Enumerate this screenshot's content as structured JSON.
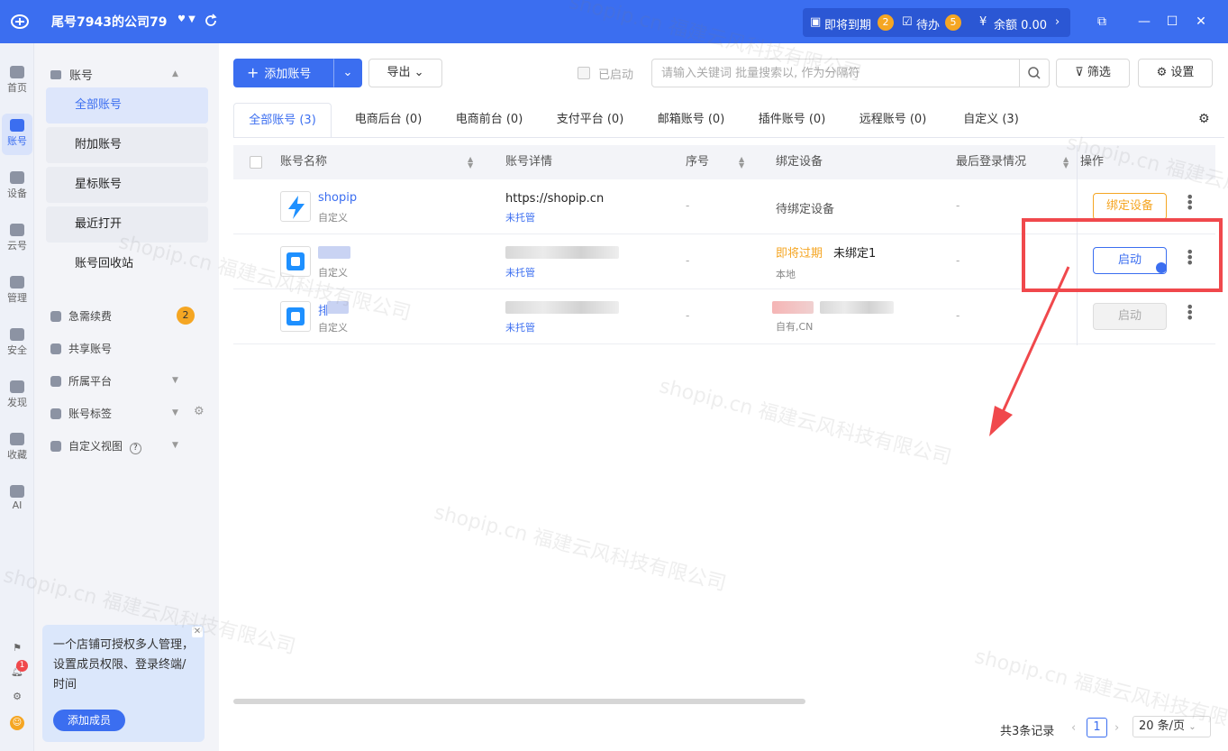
{
  "titlebar": {
    "company": "尾号7943的公司79",
    "expiring_label": "即将到期",
    "expiring_count": "2",
    "todo_label": "待办",
    "todo_count": "5",
    "balance_label": "余额 0.00"
  },
  "rail": [
    {
      "label": "首页"
    },
    {
      "label": "账号"
    },
    {
      "label": "设备"
    },
    {
      "label": "云号"
    },
    {
      "label": "管理"
    },
    {
      "label": "安全"
    },
    {
      "label": "发现"
    },
    {
      "label": "收藏"
    },
    {
      "label": "AI"
    }
  ],
  "notification_count": "1",
  "sidebar": {
    "section_title": "账号",
    "items": [
      "全部账号",
      "附加账号",
      "星标账号",
      "最近打开",
      "账号回收站"
    ],
    "groups": [
      {
        "label": "急需续费",
        "badge": "2"
      },
      {
        "label": "共享账号"
      },
      {
        "label": "所属平台"
      },
      {
        "label": "账号标签"
      },
      {
        "label": "自定义视图"
      }
    ],
    "promo_text": "一个店铺可授权多人管理，设置成员权限、登录终端/时间",
    "promo_button": "添加成员"
  },
  "toolbar": {
    "add_account": "添加账号",
    "export": "导出",
    "launched_label": "已启动",
    "search_placeholder": "请输入关键词 批量搜索以, 作为分隔符",
    "filter": "筛选",
    "settings": "设置"
  },
  "tabs": [
    "全部账号 (3)",
    "电商后台 (0)",
    "电商前台 (0)",
    "支付平台 (0)",
    "邮箱账号 (0)",
    "插件账号 (0)",
    "远程账号 (0)",
    "自定义 (3)"
  ],
  "table": {
    "columns": [
      "账号名称",
      "账号详情",
      "序号",
      "绑定设备",
      "最后登录情况",
      "操作"
    ],
    "rows": [
      {
        "name": "shopip",
        "type": "自定义",
        "detail": "https://shopip.cn",
        "hosting": "未托管",
        "seq": "-",
        "device": "待绑定设备",
        "device_sub": "",
        "last_login": "-",
        "action": "绑定设备"
      },
      {
        "name": "",
        "type": "自定义",
        "detail": "",
        "hosting": "未托管",
        "seq": "-",
        "device_warn": "即将过期",
        "device": "未绑定1",
        "device_sub": "本地",
        "last_login": "-",
        "action": "启动"
      },
      {
        "name": "排",
        "type": "自定义",
        "detail": "",
        "hosting": "未托管",
        "seq": "-",
        "device": "",
        "device_sub": "自有,CN",
        "last_login": "-",
        "action": "启动"
      }
    ]
  },
  "pagination": {
    "total": "共3条记录",
    "page": "1",
    "per_page": "20 条/页"
  },
  "watermark": "shopip.cn 福建云风科技有限公司"
}
